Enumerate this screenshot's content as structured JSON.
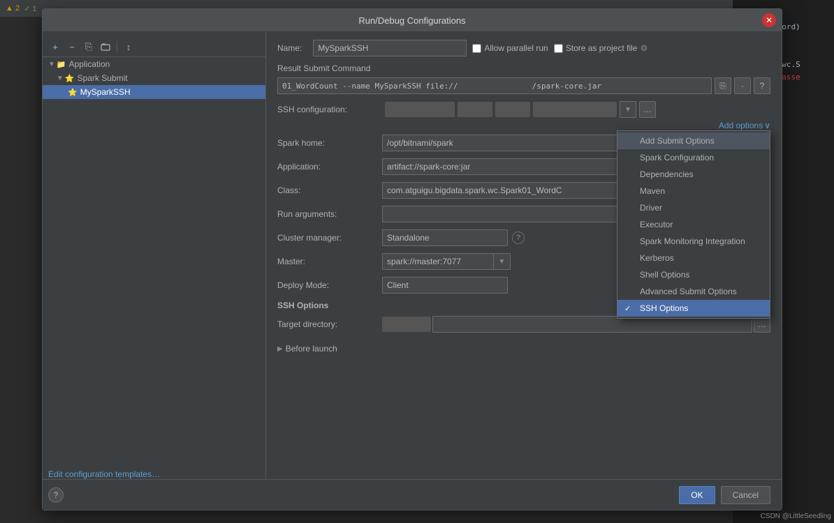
{
  "ide": {
    "topbar": {
      "badge1": "▲2",
      "badge2": "✓1"
    },
    "code_lines": [
      {
        "text": "by(word=>word)",
        "type": "normal"
      },
      {
        "text": "",
        "type": "normal"
      },
      {
        "text": "",
        "type": "normal"
      },
      {
        "text": "ata.spark.wc.S",
        "type": "normal"
      },
      {
        "text": "in-java classe",
        "type": "red"
      }
    ]
  },
  "dialog": {
    "title": "Run/Debug Configurations",
    "close_char": "✕",
    "toolbar": {
      "add": "+",
      "remove": "−",
      "copy": "⎘",
      "folder": "📁",
      "sort": "↕"
    },
    "tree": {
      "items": [
        {
          "label": "Application",
          "indent": 0,
          "type": "folder",
          "expanded": true
        },
        {
          "label": "Spark Submit",
          "indent": 1,
          "type": "star-folder",
          "expanded": true
        },
        {
          "label": "MySparkSSH",
          "indent": 2,
          "type": "star",
          "selected": true
        }
      ]
    },
    "edit_link": "Edit configuration templates…",
    "form": {
      "name_label": "Name:",
      "name_value": "MySparkSSH",
      "allow_parallel_label": "Allow parallel run",
      "store_project_label": "Store as project file",
      "result_command_label": "Result Submit Command",
      "result_command_value": "01_WordCount --name MySparkSSH file://                  /spark-core.jar",
      "ssh_config_label": "SSH configuration:",
      "spark_home_label": "Spark home:",
      "spark_home_value": "/opt/bitnami/spark",
      "application_label": "Application:",
      "application_value": "artifact://spark-core:jar",
      "class_label": "Class:",
      "class_value": "com.atguigu.bigdata.spark.wc.Spark01_WordC",
      "run_args_label": "Run arguments:",
      "run_args_value": "",
      "cluster_manager_label": "Cluster manager:",
      "cluster_manager_value": "Standalone",
      "master_label": "Master:",
      "master_value": "spark://master:7077",
      "deploy_mode_label": "Deploy Mode:",
      "deploy_mode_value": "Client",
      "ssh_options_header": "SSH Options",
      "target_dir_label": "Target directory:",
      "target_dir_value": "",
      "before_launch_label": "Before launch"
    },
    "add_options": {
      "label": "Add options",
      "chevron": "∨",
      "menu_items": [
        {
          "label": "Add Submit Options",
          "selected": false
        },
        {
          "label": "Spark Configuration",
          "selected": false
        },
        {
          "label": "Dependencies",
          "selected": false
        },
        {
          "label": "Maven",
          "selected": false
        },
        {
          "label": "Driver",
          "selected": false
        },
        {
          "label": "Executor",
          "selected": false
        },
        {
          "label": "Spark Monitoring Integration",
          "selected": false
        },
        {
          "label": "Kerberos",
          "selected": false
        },
        {
          "label": "Shell Options",
          "selected": false
        },
        {
          "label": "Advanced Submit Options",
          "selected": false
        },
        {
          "label": "SSH Options",
          "selected": true,
          "active": true
        }
      ]
    },
    "footer": {
      "ok_label": "OK",
      "cancel_label": "Cancel"
    },
    "help_char": "?"
  },
  "csdn": "@LittleSeedling"
}
